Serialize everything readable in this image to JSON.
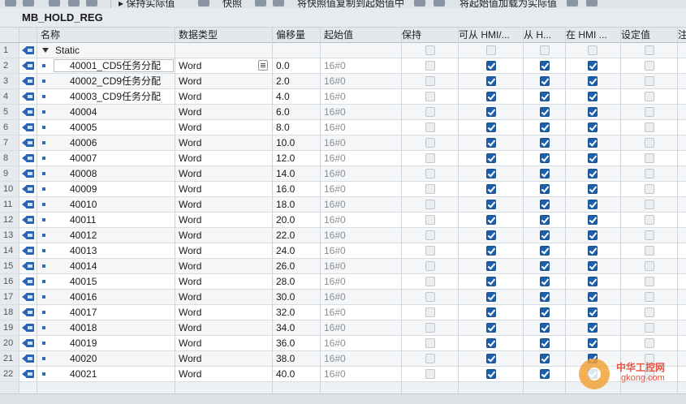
{
  "toolbar": {
    "keep_actual": "保持实际值",
    "snapshot": "快照",
    "copy_snapshot": "将快照值复制到起始值中",
    "load_start": "将起始值加载为实际值"
  },
  "block_title": "MB_HOLD_REG",
  "headers": {
    "name": "名称",
    "type": "数据类型",
    "offset": "偏移量",
    "start": "起始值",
    "retain": "保持",
    "accessible": "可从 HMI/...",
    "writable": "从 H...",
    "visible": "在 HMI ...",
    "setpoint": "设定值",
    "comment": "注"
  },
  "static_row": {
    "num": "1",
    "label": "Static"
  },
  "rows": [
    {
      "num": "2",
      "name": "40001_CD5任务分配",
      "type": "Word",
      "offset": "0.0",
      "start": "16#0"
    },
    {
      "num": "3",
      "name": "40002_CD9任务分配",
      "type": "Word",
      "offset": "2.0",
      "start": "16#0"
    },
    {
      "num": "4",
      "name": "40003_CD9任务分配",
      "type": "Word",
      "offset": "4.0",
      "start": "16#0"
    },
    {
      "num": "5",
      "name": "40004",
      "type": "Word",
      "offset": "6.0",
      "start": "16#0"
    },
    {
      "num": "6",
      "name": "40005",
      "type": "Word",
      "offset": "8.0",
      "start": "16#0"
    },
    {
      "num": "7",
      "name": "40006",
      "type": "Word",
      "offset": "10.0",
      "start": "16#0"
    },
    {
      "num": "8",
      "name": "40007",
      "type": "Word",
      "offset": "12.0",
      "start": "16#0"
    },
    {
      "num": "9",
      "name": "40008",
      "type": "Word",
      "offset": "14.0",
      "start": "16#0"
    },
    {
      "num": "10",
      "name": "40009",
      "type": "Word",
      "offset": "16.0",
      "start": "16#0"
    },
    {
      "num": "11",
      "name": "40010",
      "type": "Word",
      "offset": "18.0",
      "start": "16#0"
    },
    {
      "num": "12",
      "name": "40011",
      "type": "Word",
      "offset": "20.0",
      "start": "16#0"
    },
    {
      "num": "13",
      "name": "40012",
      "type": "Word",
      "offset": "22.0",
      "start": "16#0"
    },
    {
      "num": "14",
      "name": "40013",
      "type": "Word",
      "offset": "24.0",
      "start": "16#0"
    },
    {
      "num": "15",
      "name": "40014",
      "type": "Word",
      "offset": "26.0",
      "start": "16#0"
    },
    {
      "num": "16",
      "name": "40015",
      "type": "Word",
      "offset": "28.0",
      "start": "16#0"
    },
    {
      "num": "17",
      "name": "40016",
      "type": "Word",
      "offset": "30.0",
      "start": "16#0"
    },
    {
      "num": "18",
      "name": "40017",
      "type": "Word",
      "offset": "32.0",
      "start": "16#0"
    },
    {
      "num": "19",
      "name": "40018",
      "type": "Word",
      "offset": "34.0",
      "start": "16#0"
    },
    {
      "num": "20",
      "name": "40019",
      "type": "Word",
      "offset": "36.0",
      "start": "16#0"
    },
    {
      "num": "21",
      "name": "40020",
      "type": "Word",
      "offset": "38.0",
      "start": "16#0"
    },
    {
      "num": "22",
      "name": "40021",
      "type": "Word",
      "offset": "40.0",
      "start": "16#0"
    }
  ],
  "watermark": {
    "title": "中华工控网",
    "url": "gkong.com"
  },
  "colors": {
    "accent": "#1d5fa8",
    "icon_blue": "#2a64b6",
    "header_bg": "#e4e8ec"
  }
}
